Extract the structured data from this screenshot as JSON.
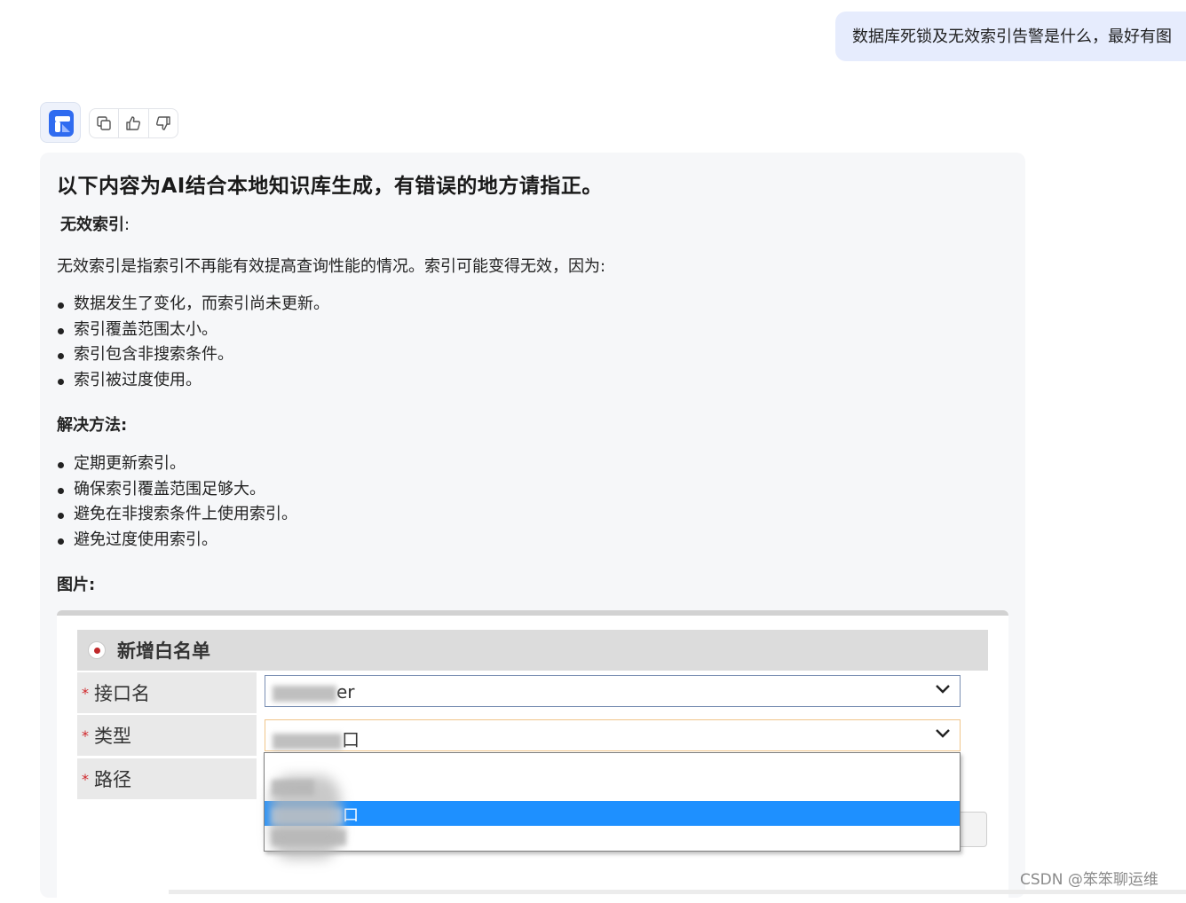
{
  "user_message": "数据库死锁及无效索引告警是什么，最好有图",
  "bot": {
    "avatar_icon": "app-logo-icon",
    "actions": [
      {
        "icon": "copy-icon"
      },
      {
        "icon": "thumbs-up-icon"
      },
      {
        "icon": "thumbs-down-icon"
      }
    ]
  },
  "answer": {
    "heading": "以下内容为AI结合本地知识库生成，有错误的地方请指正。",
    "section1_title": "无效索引",
    "section1_colon": ":",
    "section1_intro": "无效索引是指索引不再能有效提高查询性能的情况。索引可能变得无效，因为:",
    "causes": [
      "数据发生了变化，而索引尚未更新。",
      "索引覆盖范围太小。",
      "索引包含非搜索条件。",
      "索引被过度使用。"
    ],
    "solutions_title": "解决方法:",
    "solutions": [
      "定期更新索引。",
      "确保索引覆盖范围足够大。",
      "避免在非搜索条件上使用索引。",
      "避免过度使用索引。"
    ],
    "image_title": "图片:"
  },
  "embedded_form": {
    "panel_title": "新增白名单",
    "required_mark": "*",
    "fields": [
      {
        "label": "接口名",
        "value_suffix": "er"
      },
      {
        "label": "类型",
        "value_suffix": "口"
      },
      {
        "label": "路径"
      }
    ],
    "dropdown_selected_suffix": "口"
  },
  "watermark": "CSDN @笨笨聊运维",
  "colors": {
    "user_bubble": "#e6ecfd",
    "card_bg": "#f6f7f9",
    "selected_option": "#1e90ff",
    "required_star": "#d0262a"
  }
}
